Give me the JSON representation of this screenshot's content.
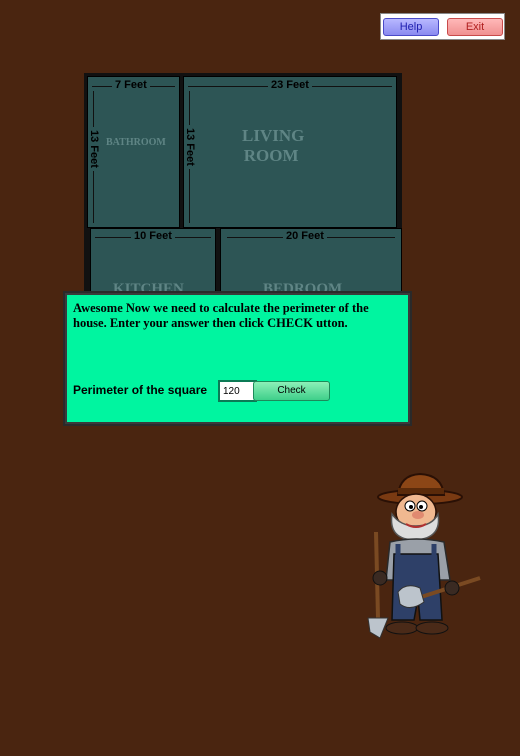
{
  "toolbar": {
    "help_label": "Help",
    "exit_label": "Exit"
  },
  "floorplan": {
    "rooms": {
      "bathroom": {
        "label": "BATHROOM",
        "width_label": "7 Feet",
        "height_label": "13 Feet"
      },
      "living_room": {
        "label_line1": "LIVING",
        "label_line2": "ROOM",
        "width_label": "23 Feet",
        "height_label": "13 Feet"
      },
      "kitchen": {
        "label": "KITCHEN",
        "width_label": "10 Feet"
      },
      "bedroom": {
        "label": "BEDROOM",
        "width_label": "20 Feet"
      }
    }
  },
  "panel": {
    "message": "Awesome Now we need to calculate the perimeter of the house. Enter your answer then click CHECK utton.",
    "input_label": "Perimeter of the square",
    "input_value": "120",
    "check_label": "Check"
  },
  "character": {
    "icon": "prospector-character"
  },
  "colors": {
    "background": "#4a2510",
    "panel": "#00f5a0",
    "room": "#2d5555"
  }
}
